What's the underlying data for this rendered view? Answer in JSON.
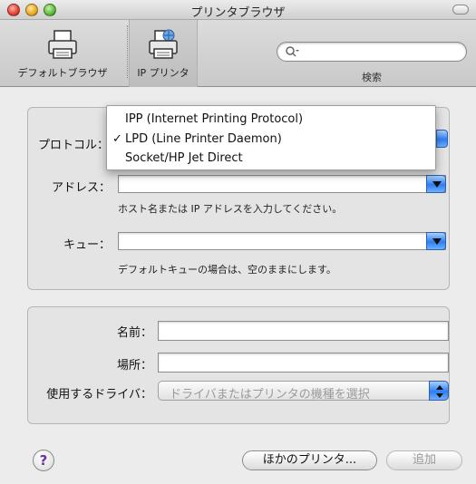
{
  "window": {
    "title": "プリンタブラウザ"
  },
  "toolbar": {
    "default_browser_label": "デフォルトブラウザ",
    "ip_printer_label": "IP プリンタ",
    "search_label": "検索",
    "search_placeholder": ""
  },
  "form": {
    "protocol_label": "プロトコル：",
    "protocol_selected": "LPD (Line Printer Daemon)",
    "protocol_options": [
      "IPP (Internet Printing Protocol)",
      "LPD (Line Printer Daemon)",
      "Socket/HP Jet Direct"
    ],
    "address_label": "アドレス：",
    "address_value": "",
    "address_hint": "ホスト名または IP アドレスを入力してください。",
    "queue_label": "キュー：",
    "queue_value": "",
    "queue_hint": "デフォルトキューの場合は、空のままにします。"
  },
  "printer_info": {
    "name_label": "名前：",
    "name_value": "",
    "location_label": "場所：",
    "location_value": "",
    "driver_label": "使用するドライバ：",
    "driver_placeholder": "ドライバまたはプリンタの機種を選択"
  },
  "footer": {
    "help_label": "?",
    "more_printers_label": "ほかのプリンタ...",
    "add_label": "追加"
  },
  "icons": {
    "check": "checkmark-icon",
    "help": "help-icon",
    "search": "search-icon",
    "default_printer": "printer-icon",
    "ip_printer": "network-printer-icon"
  },
  "colors": {
    "accent": "#2d7ef3",
    "help_text": "#6a2fa8"
  }
}
